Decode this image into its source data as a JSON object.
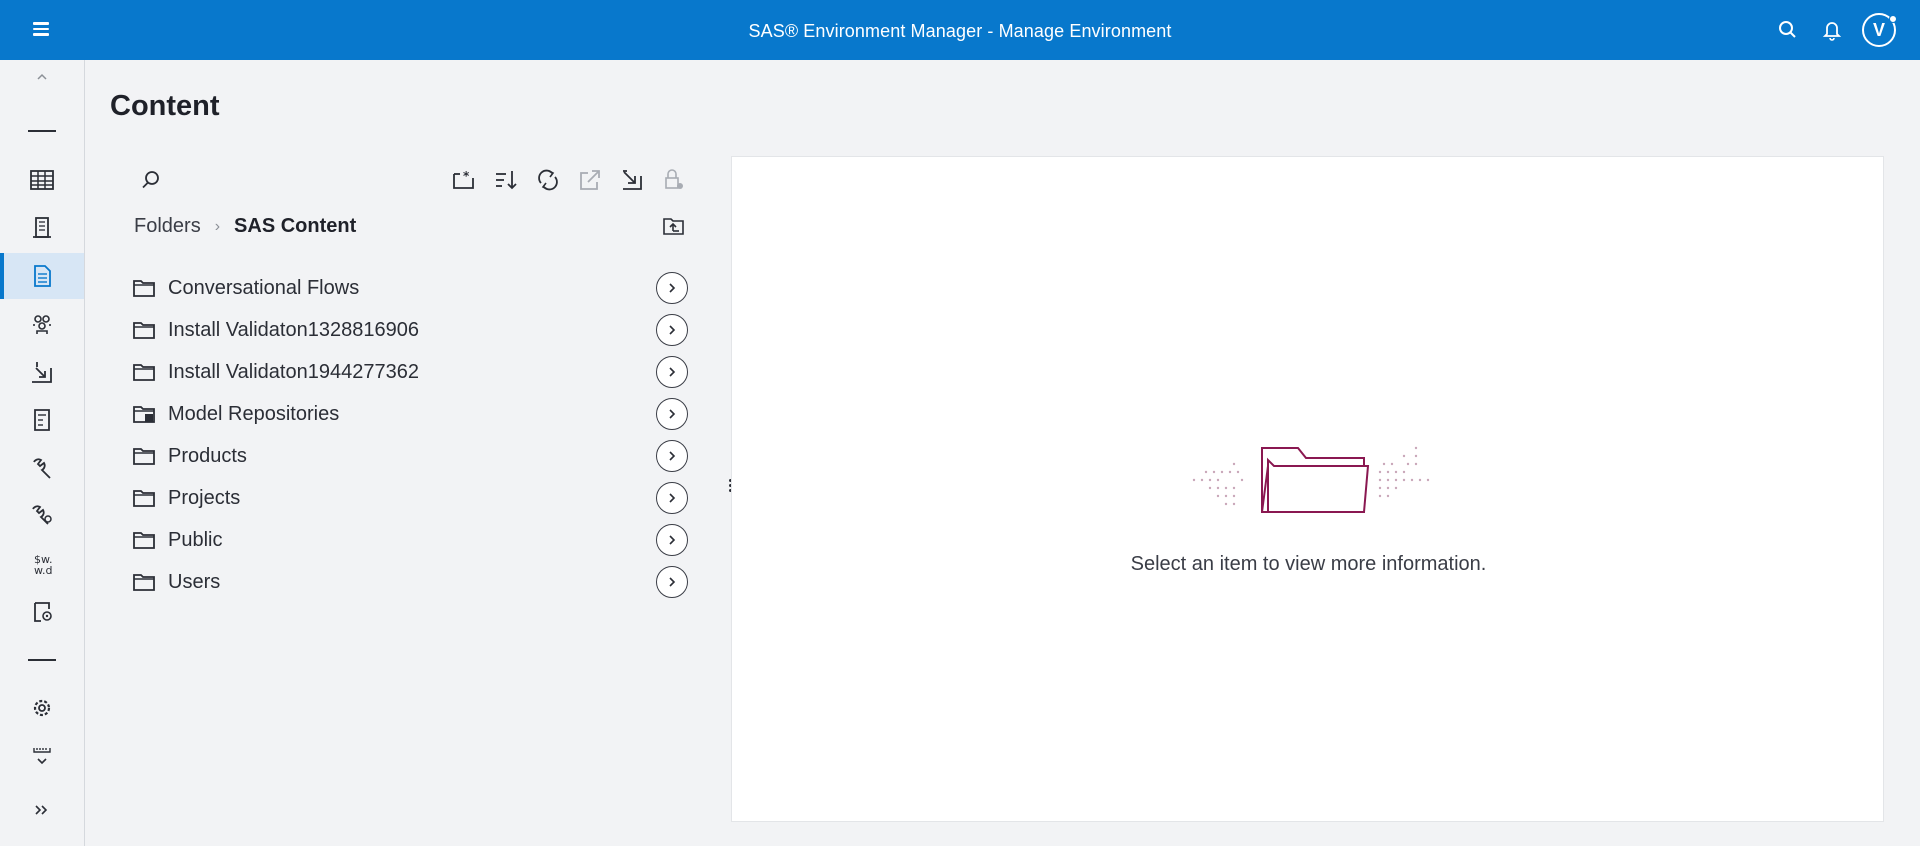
{
  "header": {
    "title": "SAS® Environment Manager - Manage Environment",
    "avatar_initial": "V"
  },
  "rail": {
    "items": [
      {
        "name": "collapse-up",
        "icon": "chevron-up-icon"
      },
      {
        "name": "tables",
        "icon": "table-grid-icon"
      },
      {
        "name": "servers",
        "icon": "building-icon"
      },
      {
        "name": "content",
        "icon": "document-icon",
        "active": true
      },
      {
        "name": "users",
        "icon": "users-icon"
      },
      {
        "name": "import",
        "icon": "import-icon"
      },
      {
        "name": "reports",
        "icon": "report-icon"
      },
      {
        "name": "tools",
        "icon": "wrench-icon"
      },
      {
        "name": "configuration",
        "icon": "wrench-gear-icon"
      },
      {
        "name": "formats",
        "icon": "formats-icon",
        "text": "$w.\nw.d"
      },
      {
        "name": "jobs",
        "icon": "job-gear-icon"
      },
      {
        "name": "settings",
        "icon": "gear-icon"
      },
      {
        "name": "more",
        "icon": "chevron-down-icon"
      },
      {
        "name": "expand",
        "icon": "double-chevron-right-icon"
      }
    ]
  },
  "page": {
    "title": "Content"
  },
  "breadcrumb": {
    "root": "Folders",
    "current": "SAS Content"
  },
  "folders": [
    {
      "name": "Conversational Flows",
      "icon": "folder-icon"
    },
    {
      "name": "Install Validaton1328816906",
      "icon": "folder-icon"
    },
    {
      "name": "Install Validaton1944277362",
      "icon": "folder-icon"
    },
    {
      "name": "Model Repositories",
      "icon": "repository-folder-icon"
    },
    {
      "name": "Products",
      "icon": "folder-icon"
    },
    {
      "name": "Projects",
      "icon": "folder-icon"
    },
    {
      "name": "Public",
      "icon": "folder-icon"
    },
    {
      "name": "Users",
      "icon": "folder-icon"
    }
  ],
  "detail": {
    "empty_message": "Select an item to view more information."
  },
  "colors": {
    "brand": "#0878cc",
    "illustration": "#8a1851"
  }
}
